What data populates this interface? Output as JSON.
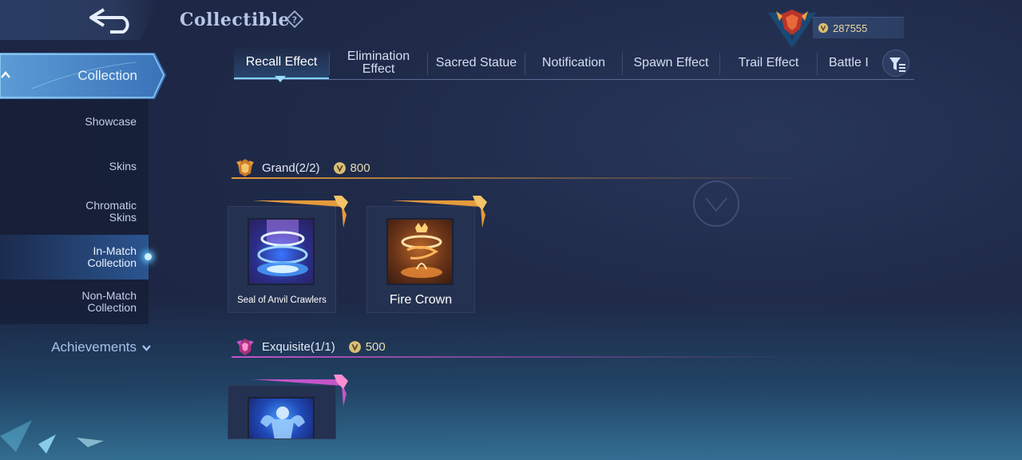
{
  "header": {
    "title": "Collectible",
    "currency_value": "287555"
  },
  "sidebar": {
    "collection_label": "Collection",
    "items": [
      {
        "label": "Showcase"
      },
      {
        "label": "Skins"
      },
      {
        "label": "Chromatic Skins"
      },
      {
        "label": "In-Match Collection",
        "active": true
      },
      {
        "label": "Non-Match Collection"
      }
    ],
    "achievements_label": "Achievements"
  },
  "tabs": [
    {
      "label": "Recall Effect",
      "active": true
    },
    {
      "label": "Elimination Effect"
    },
    {
      "label": "Sacred Statue"
    },
    {
      "label": "Notification"
    },
    {
      "label": "Spawn Effect"
    },
    {
      "label": "Trail Effect"
    },
    {
      "label": "Battle I"
    }
  ],
  "sections": {
    "grand": {
      "label": "Grand(2/2)",
      "points": "800",
      "color": "#e59a3c",
      "items": [
        {
          "name": "Seal of Anvil Crawlers"
        },
        {
          "name": "Fire Crown"
        }
      ]
    },
    "exquisite": {
      "label": "Exquisite(1/1)",
      "points": "500",
      "color": "#c455c9",
      "items": [
        {
          "name": ""
        }
      ]
    }
  },
  "colors": {
    "accent_blue": "#5fc4ff",
    "gold": "#e8dcb4",
    "background": "#1f2a48"
  }
}
